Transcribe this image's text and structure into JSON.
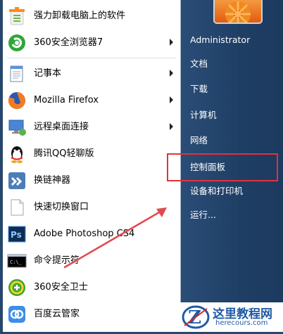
{
  "left_items": [
    {
      "label": "强力卸载电脑上的软件",
      "icon": "uninstall-icon",
      "has_submenu": false
    },
    {
      "label": "360安全浏览器7",
      "icon": "360-browser-icon",
      "has_submenu": true
    },
    {
      "label": "记事本",
      "icon": "notepad-icon",
      "has_submenu": true
    },
    {
      "label": "Mozilla Firefox",
      "icon": "firefox-icon",
      "has_submenu": true
    },
    {
      "label": "远程桌面连接",
      "icon": "remote-desktop-icon",
      "has_submenu": true
    },
    {
      "label": "腾讯QQ轻聊版",
      "icon": "qq-icon",
      "has_submenu": false
    },
    {
      "label": "换链神器",
      "icon": "link-tool-icon",
      "has_submenu": false
    },
    {
      "label": "快速切换窗口",
      "icon": "switch-window-icon",
      "has_submenu": false
    },
    {
      "label": "Adobe Photoshop CS4",
      "icon": "photoshop-icon",
      "has_submenu": false
    },
    {
      "label": "命令提示符",
      "icon": "cmd-icon",
      "has_submenu": false
    },
    {
      "label": "360安全卫士",
      "icon": "360-safe-icon",
      "has_submenu": false
    },
    {
      "label": "百度云管家",
      "icon": "baidu-cloud-icon",
      "has_submenu": false
    }
  ],
  "right_items": [
    {
      "label": "Administrator"
    },
    {
      "label": "文档"
    },
    {
      "label": "下载"
    },
    {
      "label": "计算机"
    },
    {
      "label": "网络"
    },
    {
      "label": "控制面板"
    },
    {
      "label": "设备和打印机"
    },
    {
      "label": "运行..."
    }
  ],
  "watermark": {
    "title": "这里教程网",
    "url": "herecours.com"
  },
  "colors": {
    "highlight": "#e2323b",
    "right_panel": "#1f3e64"
  }
}
